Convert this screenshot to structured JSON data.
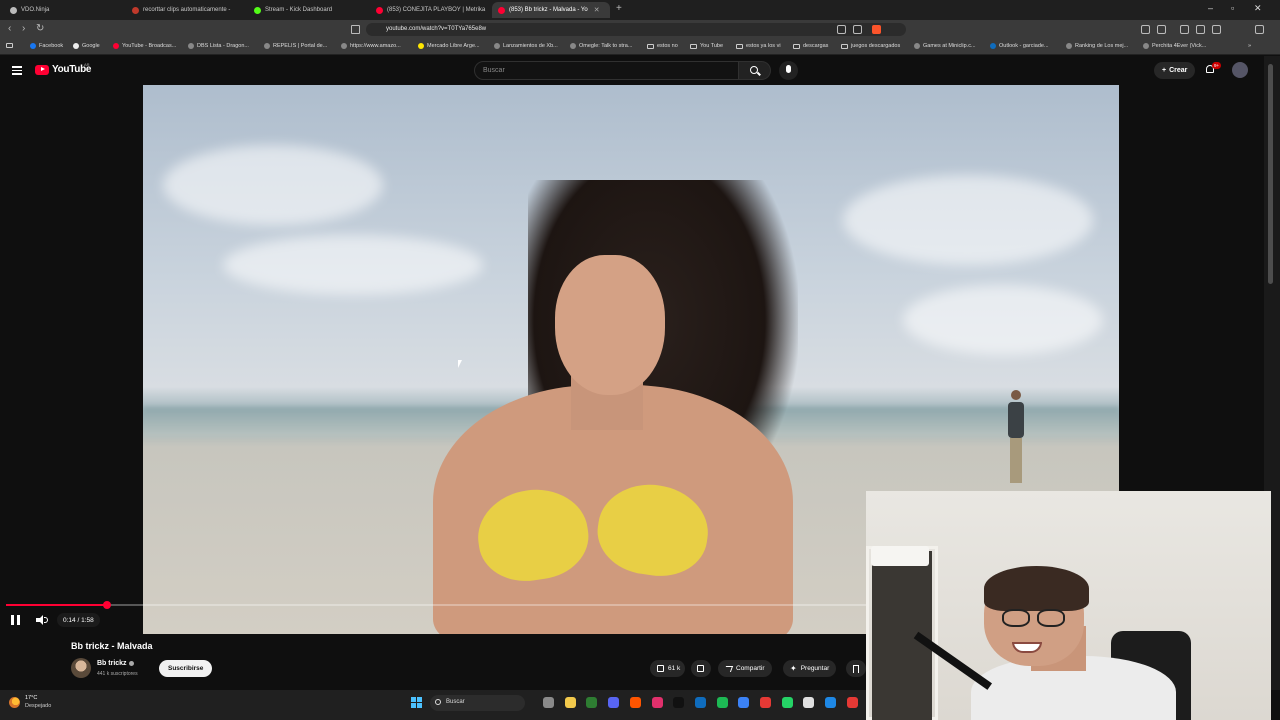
{
  "browser": {
    "tabs": [
      {
        "title": "VDO.Ninja",
        "favcolor": "#bbbbbb"
      },
      {
        "title": "recorttar clips automaticamente -",
        "favcolor": "#c0392b"
      },
      {
        "title": "Stream - Kick Dashboard",
        "favcolor": "#53fc18"
      },
      {
        "title": "(853) CONEJITA PLAYBOY | Metrika",
        "favcolor": "#ff0033"
      },
      {
        "title": "(853) Bb trickz - Malvada - Yo",
        "favcolor": "#ff0033",
        "active": true
      }
    ],
    "url": "youtube.com/watch?v=T0TYa765e8w",
    "bookmarks": [
      "Facebook",
      "Google",
      "YouTube - Broadcas...",
      "DBS Lista - Dragon...",
      "REPELIS | Portal de...",
      "https://www.amazo...",
      "Mercado Libre Arge...",
      "Lanzamientos de Xb...",
      "Omegle: Talk to stra...",
      "estos no",
      "You Tube",
      "estos ya los vi",
      "descargas",
      "juegos descargados",
      "Games at Miniclip.c...",
      "Outlook - garciade...",
      "Ranking de Los mej...",
      "Perchita 4Ever (Vick..."
    ]
  },
  "youtube": {
    "logo_text": "YouTube",
    "region": "AR",
    "search_placeholder": "Buscar",
    "create_label": "Crear",
    "notif_count": "9+"
  },
  "player": {
    "time_display": "0:14 / 1:58",
    "progress_fraction": 0.118
  },
  "video_info": {
    "title": "Bb trickz - Malvada",
    "channel": "Bb trickz",
    "subscribers": "441 k suscriptores",
    "subscribe_label": "Suscribirse",
    "likes": "61 k",
    "share_label": "Compartir",
    "ask_label": "Preguntar"
  },
  "taskbar": {
    "temperature": "17°C",
    "weather": "Despejado",
    "search_label": "Buscar",
    "app_colors": [
      "#8a8a8a",
      "#f2c94c",
      "#2e7d32",
      "#5865f2",
      "#ff5500",
      "#e1306c",
      "#111111",
      "#0f6cbd",
      "#1db954",
      "#3b82f6",
      "#e53935",
      "#25d366",
      "#e0e0e0",
      "#1e88e5",
      "#e53935"
    ]
  }
}
